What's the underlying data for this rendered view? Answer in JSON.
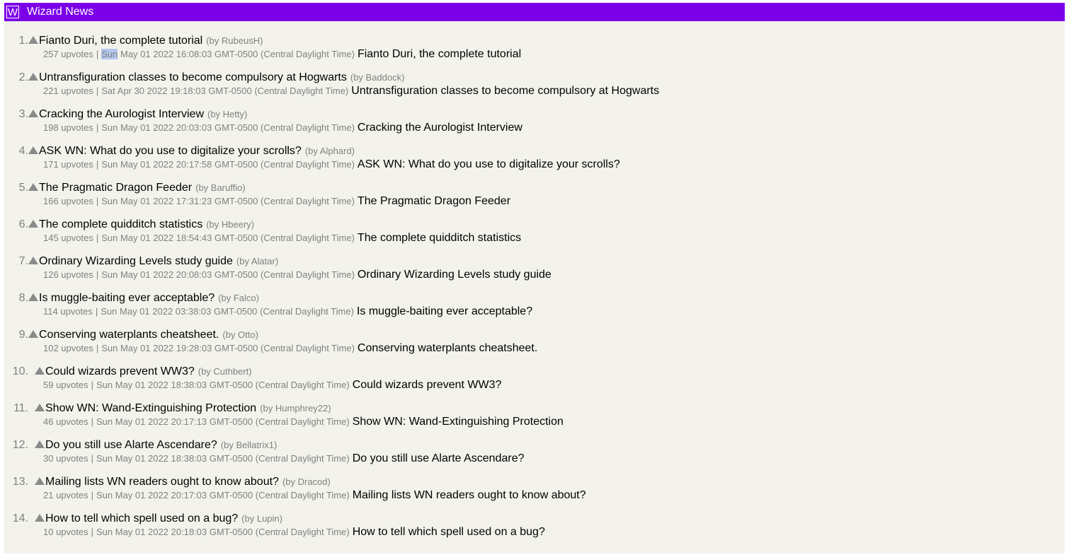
{
  "header": {
    "logo": "W",
    "title": "Wizard News",
    "color": "#7b00e8"
  },
  "posts": [
    {
      "rank": "1.",
      "title": "Fianto Duri, the complete tutorial",
      "byline": "(by RubeusH)",
      "upvotes": "257 upvotes",
      "date": "Sun May 01 2022 16:08:03 GMT-0500 (Central Daylight Time)",
      "content": "Fianto Duri, the complete tutorial"
    },
    {
      "rank": "2.",
      "title": "Untransfiguration classes to become compulsory at Hogwarts",
      "byline": "(by Baddock)",
      "upvotes": "221 upvotes",
      "date": "Sat Apr 30 2022 19:18:03 GMT-0500 (Central Daylight Time)",
      "content": "Untransfiguration classes to become compulsory at Hogwarts"
    },
    {
      "rank": "3.",
      "title": "Cracking the Aurologist Interview",
      "byline": "(by Hetty)",
      "upvotes": "198 upvotes",
      "date": "Sun May 01 2022 20:03:03 GMT-0500 (Central Daylight Time)",
      "content": "Cracking the Aurologist Interview"
    },
    {
      "rank": "4.",
      "title": "ASK WN: What do you use to digitalize your scrolls?",
      "byline": "(by Alphard)",
      "upvotes": "171 upvotes",
      "date": "Sun May 01 2022 20:17:58 GMT-0500 (Central Daylight Time)",
      "content": "ASK WN: What do you use to digitalize your scrolls?"
    },
    {
      "rank": "5.",
      "title": "The Pragmatic Dragon Feeder",
      "byline": "(by Baruffio)",
      "upvotes": "166 upvotes",
      "date": "Sun May 01 2022 17:31:23 GMT-0500 (Central Daylight Time)",
      "content": "The Pragmatic Dragon Feeder"
    },
    {
      "rank": "6.",
      "title": "The complete quidditch statistics",
      "byline": "(by Hbeery)",
      "upvotes": "145 upvotes",
      "date": "Sun May 01 2022 18:54:43 GMT-0500 (Central Daylight Time)",
      "content": "The complete quidditch statistics"
    },
    {
      "rank": "7.",
      "title": "Ordinary Wizarding Levels study guide",
      "byline": "(by Alatar)",
      "upvotes": "126 upvotes",
      "date": "Sun May 01 2022 20:08:03 GMT-0500 (Central Daylight Time)",
      "content": "Ordinary Wizarding Levels study guide"
    },
    {
      "rank": "8.",
      "title": "Is muggle-baiting ever acceptable?",
      "byline": "(by Falco)",
      "upvotes": "114 upvotes",
      "date": "Sun May 01 2022 03:38:03 GMT-0500 (Central Daylight Time)",
      "content": "Is muggle-baiting ever acceptable?"
    },
    {
      "rank": "9.",
      "title": "Conserving waterplants cheatsheet.",
      "byline": "(by Otto)",
      "upvotes": "102 upvotes",
      "date": "Sun May 01 2022 19:28:03 GMT-0500 (Central Daylight Time)",
      "content": "Conserving waterplants cheatsheet."
    },
    {
      "rank": "10.",
      "title": "Could wizards prevent WW3?",
      "byline": "(by Cuthbert)",
      "upvotes": "59 upvotes",
      "date": "Sun May 01 2022 18:38:03 GMT-0500 (Central Daylight Time)",
      "content": "Could wizards prevent WW3?"
    },
    {
      "rank": "11.",
      "title": "Show WN: Wand-Extinguishing Protection",
      "byline": "(by Humphrey22)",
      "upvotes": "46 upvotes",
      "date": "Sun May 01 2022 20:17:13 GMT-0500 (Central Daylight Time)",
      "content": "Show WN: Wand-Extinguishing Protection"
    },
    {
      "rank": "12.",
      "title": "Do you still use Alarte Ascendare?",
      "byline": "(by Bellatrix1)",
      "upvotes": "30 upvotes",
      "date": "Sun May 01 2022 18:38:03 GMT-0500 (Central Daylight Time)",
      "content": "Do you still use Alarte Ascendare?"
    },
    {
      "rank": "13.",
      "title": "Mailing lists WN readers ought to know about?",
      "byline": "(by Dracod)",
      "upvotes": "21 upvotes",
      "date": "Sun May 01 2022 20:17:03 GMT-0500 (Central Daylight Time)",
      "content": "Mailing lists WN readers ought to know about?"
    },
    {
      "rank": "14.",
      "title": "How to tell which spell used on a bug?",
      "byline": "(by Lupin)",
      "upvotes": "10 upvotes",
      "date": "Sun May 01 2022 20:18:03 GMT-0500 (Central Daylight Time)",
      "content": "How to tell which spell used on a bug?"
    }
  ]
}
